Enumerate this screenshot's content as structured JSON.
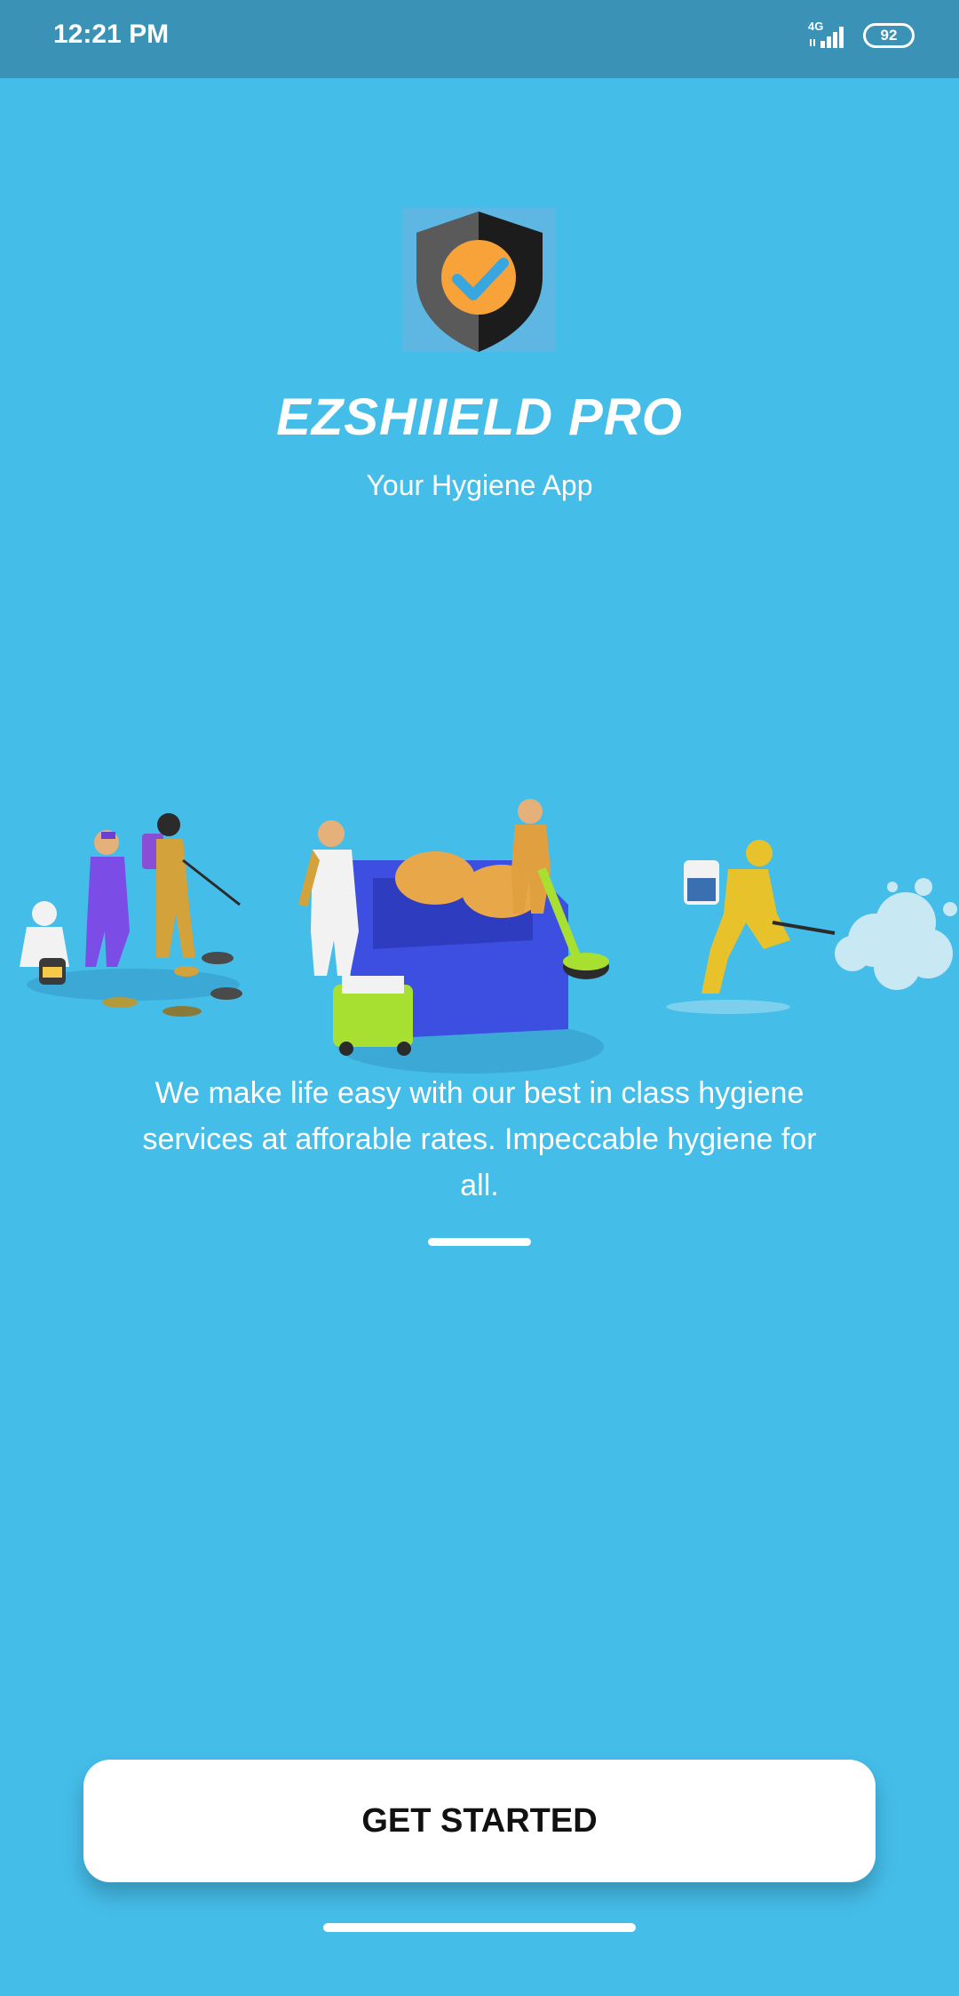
{
  "status_bar": {
    "time": "12:21 PM",
    "network": "4G",
    "battery": "92"
  },
  "brand": {
    "title": "EZSHIIELD PRO",
    "subtitle": "Your Hygiene App",
    "logo_icon": "shield-check-icon"
  },
  "onboarding": {
    "description": "We make life easy with our best in class hygiene services at afforable rates. Impeccable hygiene for all.",
    "illustration": "hygiene-services-illustration",
    "page_indicator": {
      "current": 1
    }
  },
  "actions": {
    "get_started_label": "GET STARTED"
  },
  "colors": {
    "background": "#45BDE9",
    "status_bar": "#3A92B7",
    "shield_orange": "#F7A33A",
    "shield_dark": "#1F1F1F",
    "check_blue": "#3AA6E0"
  }
}
